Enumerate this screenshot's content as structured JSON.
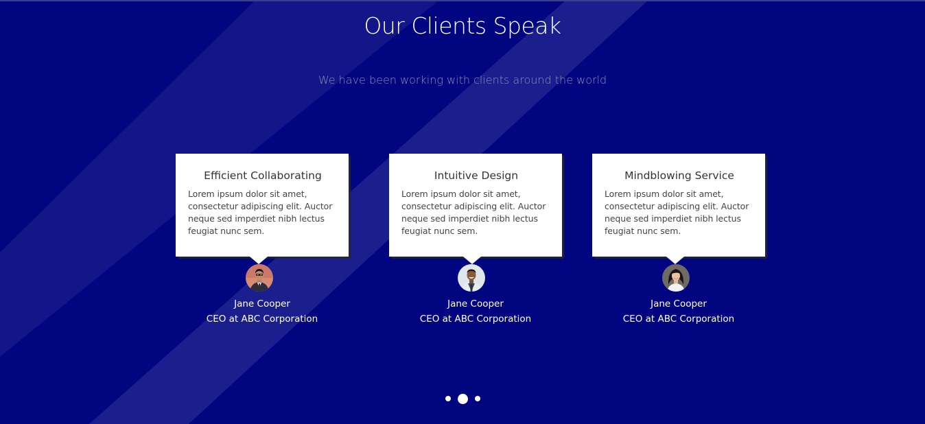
{
  "section": {
    "title": "Our Clients Speak",
    "subtitle": "We have been working with clients around the world"
  },
  "testimonials": [
    {
      "heading": "Efficient Collaborating",
      "text": "Lorem ipsum dolor sit amet, consectetur adipiscing elit. Auctor neque sed imperdiet nibh lectus feugiat nunc sem.",
      "name": "Jane Cooper",
      "role": "CEO at ABC Corporation",
      "avatar_icon": "man-in-suit-photo"
    },
    {
      "heading": "Intuitive Design",
      "text": "Lorem ipsum dolor sit amet, consectetur adipiscing elit. Auctor neque sed imperdiet nibh lectus feugiat nunc sem.",
      "name": "Jane Cooper",
      "role": "CEO at ABC Corporation",
      "avatar_icon": "smiling-man-photo"
    },
    {
      "heading": "Mindblowing Service",
      "text": "Lorem ipsum dolor sit amet, consectetur adipiscing elit. Auctor neque sed imperdiet nibh lectus feugiat nunc sem.",
      "name": "Jane Cooper",
      "role": "CEO at ABC Corporation",
      "avatar_icon": "smiling-woman-photo"
    }
  ],
  "carousel": {
    "page_count": 3,
    "active_index": 1
  },
  "colors": {
    "background": "#020580",
    "card": "#ffffff",
    "subtitle": "#8e8fb0"
  }
}
